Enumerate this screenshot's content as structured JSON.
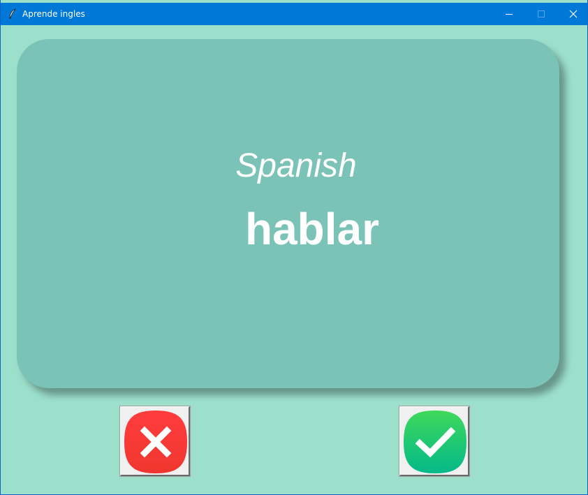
{
  "window": {
    "title": "Aprende ingles",
    "controls": {
      "minimize_icon": "minimize-icon",
      "maximize_icon": "maximize-icon",
      "close_icon": "close-icon"
    }
  },
  "card": {
    "language": "Spanish",
    "word": "hablar"
  },
  "buttons": {
    "wrong_icon": "cross-icon",
    "right_icon": "checkmark-icon"
  },
  "colors": {
    "titlebar": "#0078d7",
    "background": "#9ce0cc",
    "card": "#7bc3b6",
    "wrong": "#f2373b",
    "right": "#14c26e"
  }
}
